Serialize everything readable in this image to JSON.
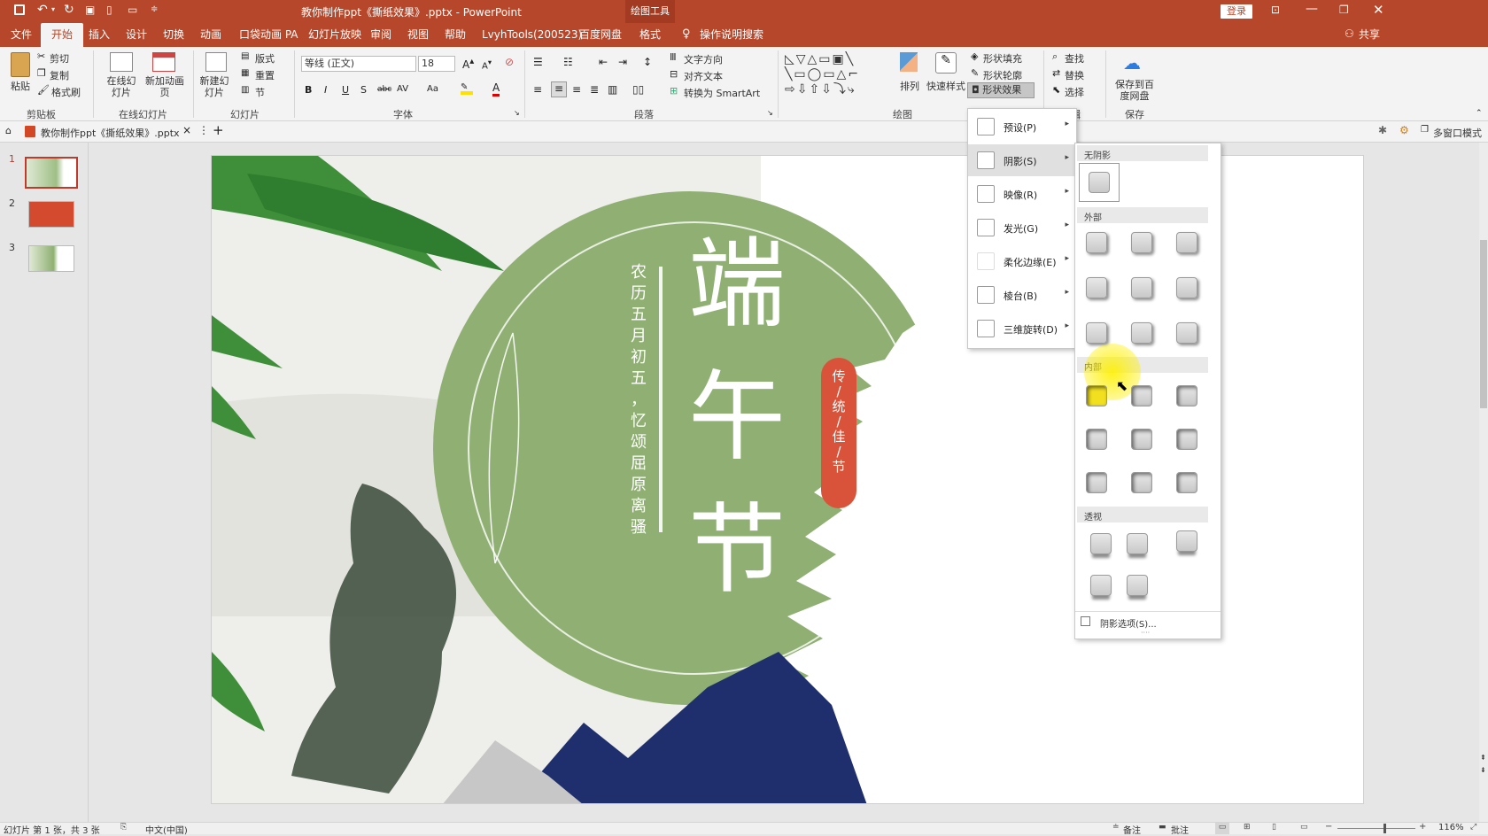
{
  "titlebar": {
    "document_title": "教你制作ppt《撕纸效果》.pptx - PowerPoint",
    "context_tab": "绘图工具",
    "login_label": "登录"
  },
  "tabs": [
    "文件",
    "开始",
    "插入",
    "设计",
    "切换",
    "动画",
    "口袋动画 PA",
    "幻灯片放映",
    "审阅",
    "视图",
    "帮助",
    "LvyhTools(200523)",
    "百度网盘",
    "格式"
  ],
  "tell_me": "操作说明搜索",
  "share_label": "共享",
  "ribbon": {
    "clipboard": {
      "paste": "粘贴",
      "cut": "剪切",
      "copy": "复制",
      "format_painter": "格式刷",
      "group": "剪贴板"
    },
    "online_slides": {
      "online": "在线幻灯片",
      "new_anim": "新加动画页",
      "group": "在线幻灯片"
    },
    "slides": {
      "new_slide": "新建幻灯片",
      "layout": "版式",
      "reset": "重置",
      "section": "节",
      "group": "幻灯片"
    },
    "font": {
      "font_name": "等线 (正文)",
      "font_size": "18",
      "group": "字体",
      "buttons": [
        "B",
        "I",
        "U",
        "S",
        "abc",
        "AV",
        "Aa",
        "A"
      ]
    },
    "paragraph": {
      "text_direction": "文字方向",
      "align_text": "对齐文本",
      "smartart": "转换为 SmartArt",
      "group": "段落"
    },
    "drawing": {
      "arrange": "排列",
      "quick_styles": "快速样式",
      "shape_fill": "形状填充",
      "shape_outline": "形状轮廓",
      "shape_effects": "形状效果",
      "group": "绘图"
    },
    "editing": {
      "find": "查找",
      "replace": "替换",
      "select": "选择",
      "group": "编辑"
    },
    "save": {
      "save_baidu": "保存到百度网盘",
      "group": "保存"
    }
  },
  "docbar": {
    "file_tab": "教你制作ppt《撕纸效果》.pptx",
    "multi_window": "多窗口模式"
  },
  "thumbnails": [
    {
      "num": "1"
    },
    {
      "num": "2"
    },
    {
      "num": "3"
    }
  ],
  "slide": {
    "main_title": [
      "端",
      "午",
      "节"
    ],
    "vertical_text": [
      "农",
      "历",
      "五",
      "月",
      "初",
      "五",
      "，",
      "忆",
      "颂",
      "屈",
      "原",
      "离",
      "骚"
    ],
    "badge": [
      "传",
      "/",
      "统",
      "/",
      "佳",
      "/",
      "节"
    ]
  },
  "effects_menu": [
    {
      "label": "预设(P)"
    },
    {
      "label": "阴影(S)"
    },
    {
      "label": "映像(R)"
    },
    {
      "label": "发光(G)"
    },
    {
      "label": "柔化边缘(E)"
    },
    {
      "label": "棱台(B)"
    },
    {
      "label": "三维旋转(D)"
    }
  ],
  "shadow_gallery": {
    "sections": [
      "无阴影",
      "外部",
      "内部",
      "透视"
    ],
    "options_label": "阴影选项(S)..."
  },
  "status": {
    "slide_info": "幻灯片 第 1 张，共 3 张",
    "language": "中文(中国)",
    "notes": "备注",
    "comments": "批注",
    "zoom": "116%"
  },
  "colors": {
    "accent": "#b7472a",
    "slide_green": "#8fb072",
    "badge_red": "#d9533a",
    "mountain_blue": "#1f2f6e"
  }
}
